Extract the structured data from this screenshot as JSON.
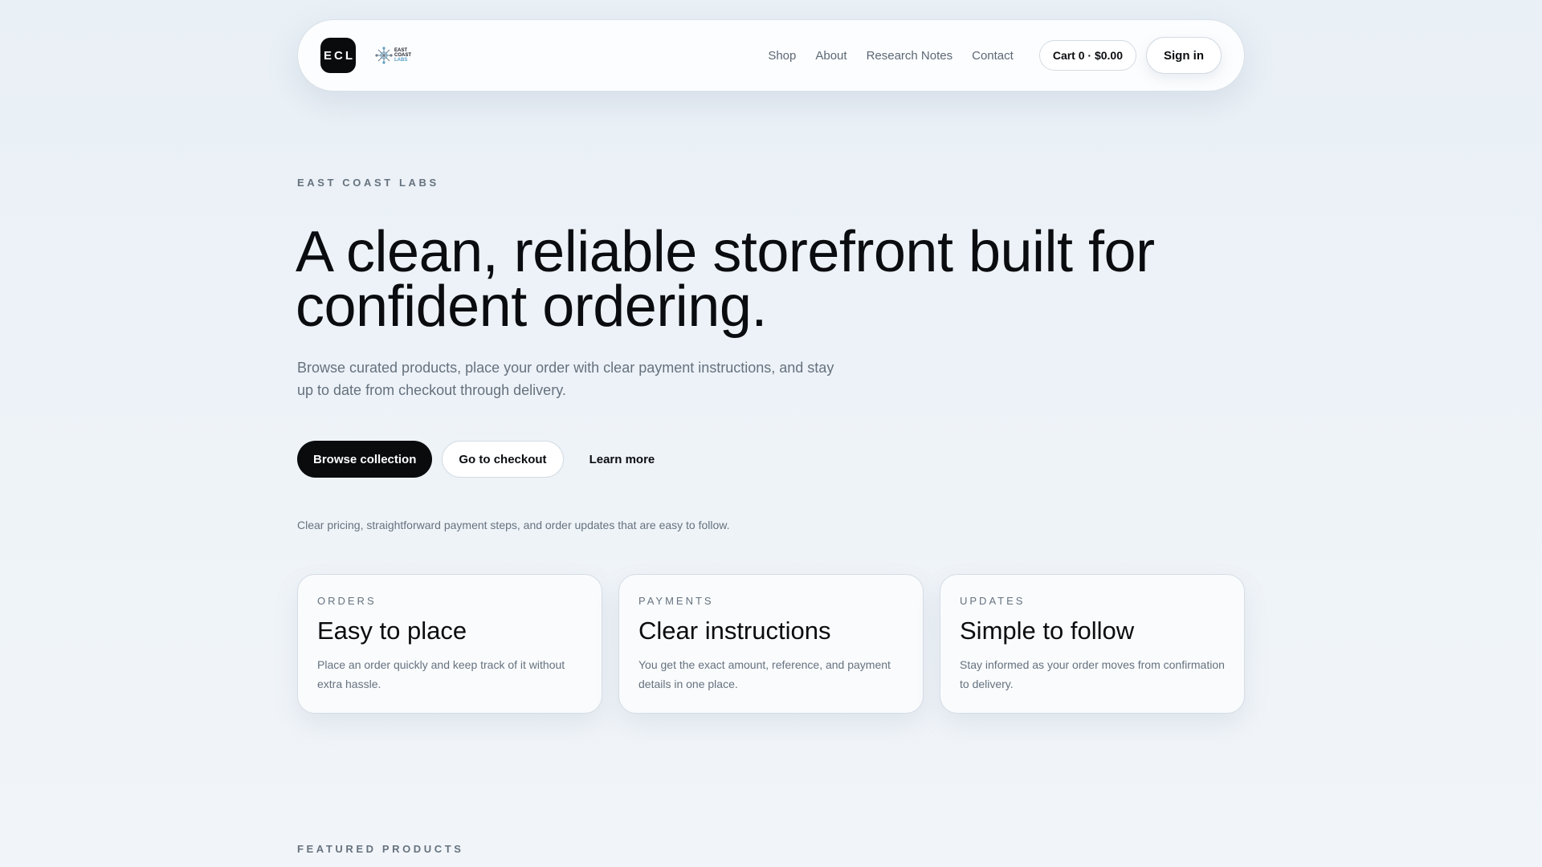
{
  "header": {
    "logo_mark": "ECL",
    "brand_logo_text": {
      "line1": "EAST",
      "line2": "COAST",
      "line3": "LABS"
    },
    "nav": [
      "Shop",
      "About",
      "Research Notes",
      "Contact"
    ],
    "cart_label": "Cart 0 · $0.00",
    "signin_label": "Sign in"
  },
  "hero": {
    "eyebrow": "EAST COAST LABS",
    "title": "A clean, reliable storefront built for confident ordering.",
    "subtitle": "Browse curated products, place your order with clear payment instructions, and stay up to date from checkout through delivery.",
    "primary_cta": "Browse collection",
    "secondary_cta": "Go to checkout",
    "tertiary_cta": "Learn more",
    "tagline": "Clear pricing, straightforward payment steps, and order updates that are easy to follow."
  },
  "cards": [
    {
      "eyebrow": "ORDERS",
      "title": "Easy to place",
      "desc": "Place an order quickly and keep track of it without extra hassle."
    },
    {
      "eyebrow": "PAYMENTS",
      "title": "Clear instructions",
      "desc": "You get the exact amount, reference, and payment details in one place."
    },
    {
      "eyebrow": "UPDATES",
      "title": "Simple to follow",
      "desc": "Stay informed as your order moves from confirmation to delivery."
    }
  ],
  "featured": {
    "eyebrow": "FEATURED PRODUCTS"
  },
  "colors": {
    "accent": "#0a0b0d",
    "muted_text": "#66727e",
    "background": "#eef3f8",
    "logo_blue": "#5aa0c8"
  }
}
